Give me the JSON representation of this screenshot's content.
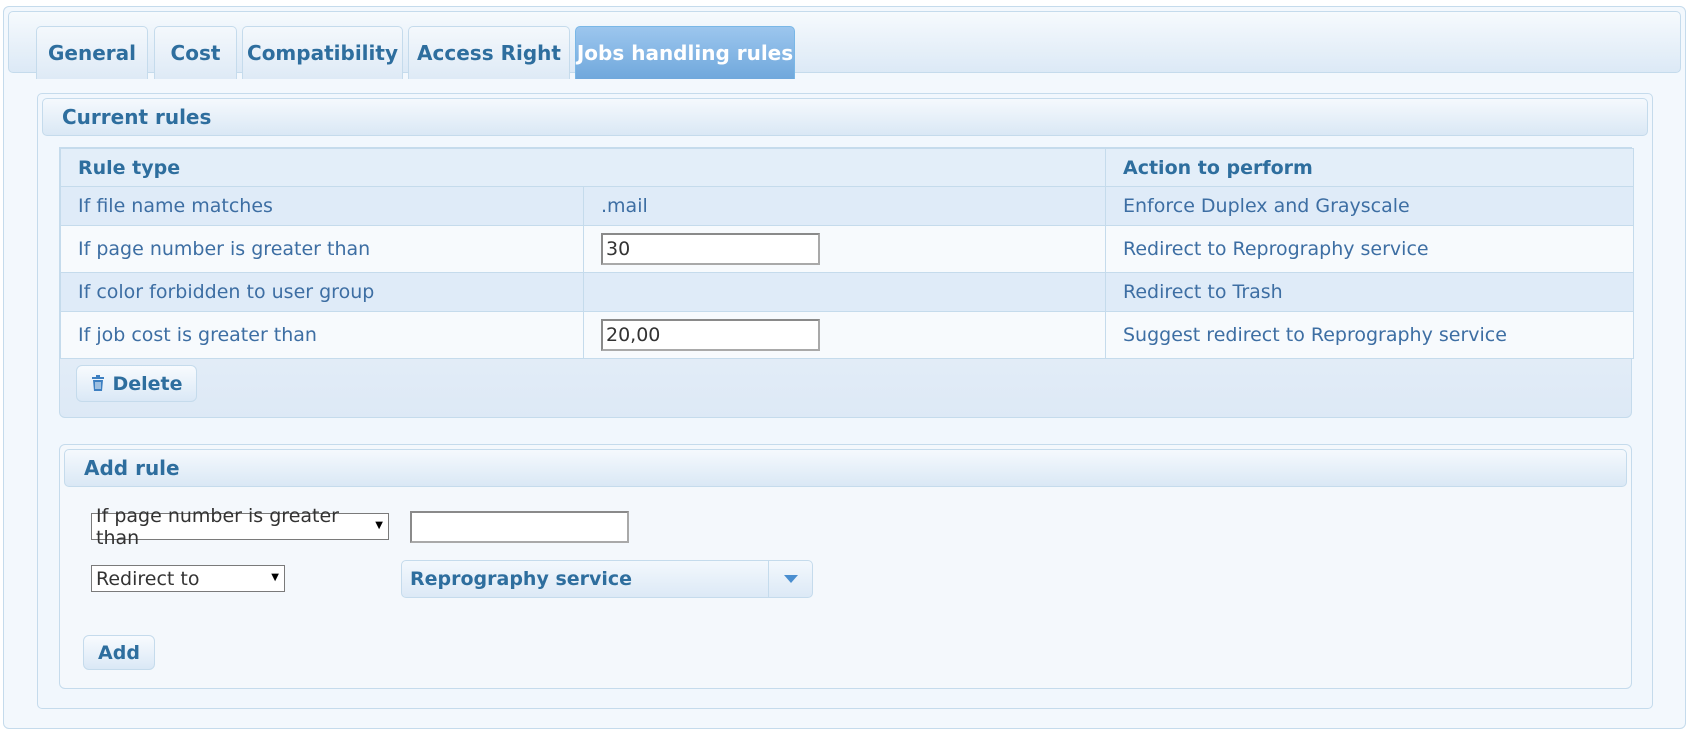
{
  "tabs": [
    {
      "label": "General"
    },
    {
      "label": "Cost"
    },
    {
      "label": "Compatibility"
    },
    {
      "label": "Access Right"
    },
    {
      "label": "Jobs handling rules",
      "active": true
    }
  ],
  "current_rules": {
    "title": "Current rules",
    "columns": {
      "rule_type": "Rule type",
      "action": "Action to perform"
    },
    "rows": [
      {
        "rule": "If file name matches",
        "value": ".mail",
        "action": "Enforce Duplex and Grayscale"
      },
      {
        "rule": "If page number is greater than",
        "input_value": "30",
        "action": "Redirect to Reprography service"
      },
      {
        "rule": "If color forbidden to user group",
        "value": "",
        "action": "Redirect to Trash"
      },
      {
        "rule": "If job cost is greater than",
        "input_value": "20,00",
        "action": "Suggest redirect to Reprography service"
      }
    ],
    "delete_label": "Delete"
  },
  "add_rule": {
    "title": "Add rule",
    "rule_select": "If page number is greater than",
    "rule_value": "",
    "action_select": "Redirect to",
    "target_combo": "Reprography service",
    "add_label": "Add"
  },
  "colors": {
    "accent": "#2e6e9e",
    "active_tab": "#70a8dc",
    "border": "#c5dbec"
  },
  "icons": {
    "delete": "trash-icon",
    "combo": "chevron-down-icon"
  }
}
